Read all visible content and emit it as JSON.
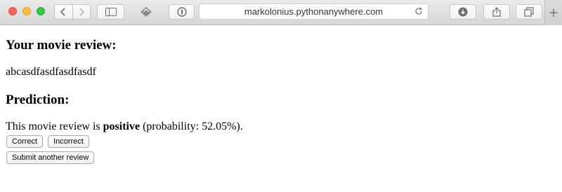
{
  "browser": {
    "url": "markolonius.pythonanywhere.com",
    "new_tab_symbol": "+"
  },
  "page": {
    "review_heading": "Your movie review:",
    "review_text": "abcasdfasdfasdfasdf",
    "prediction_heading": "Prediction:",
    "result_prefix": "This movie review is ",
    "result_label": "positive",
    "result_suffix": " (probability: 52.05%).",
    "buttons": {
      "correct": "Correct",
      "incorrect": "Incorrect",
      "submit_another": "Submit another review"
    }
  }
}
